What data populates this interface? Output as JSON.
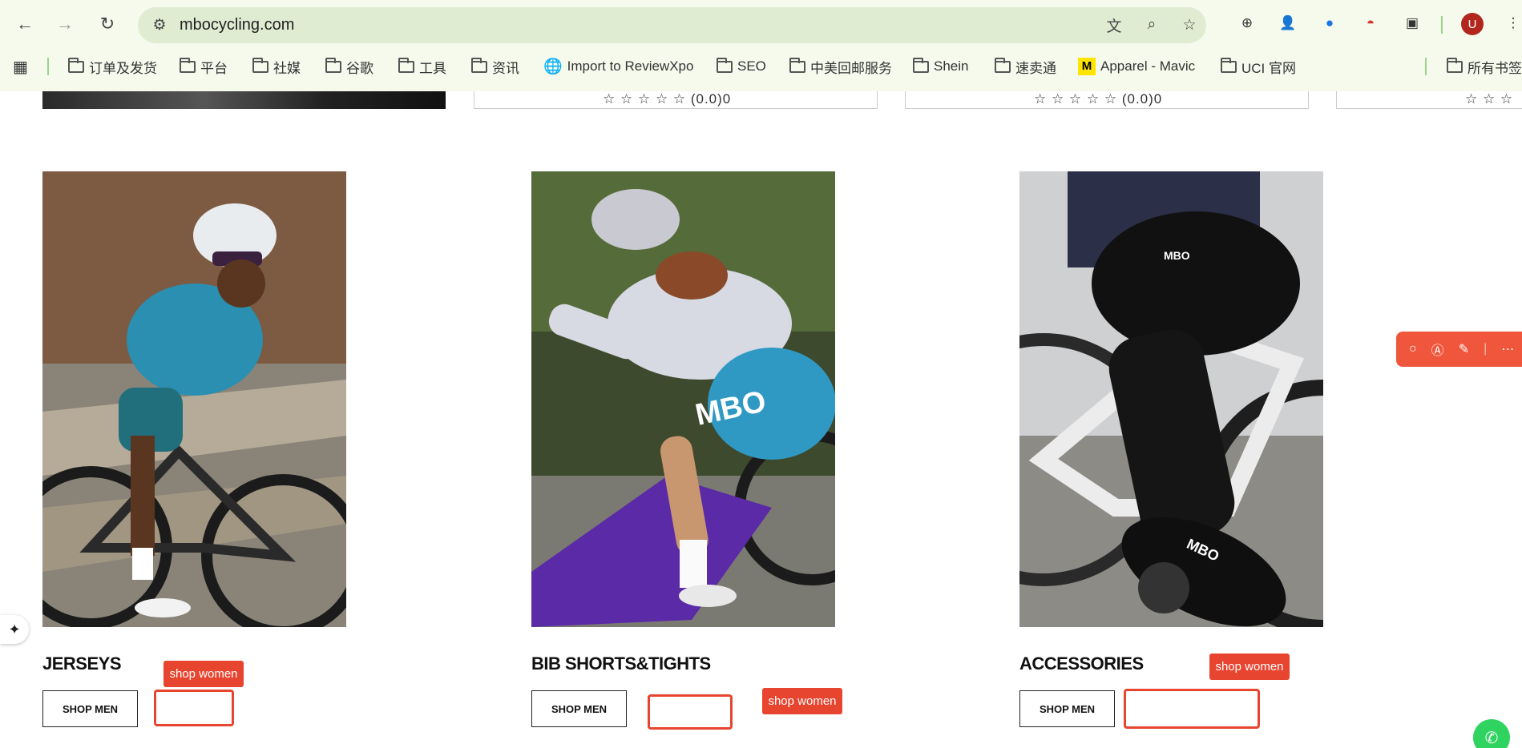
{
  "browser": {
    "url": "mbocycling.com",
    "avatar_letter": "U",
    "icons": {
      "back": "arrow-left-icon",
      "forward": "arrow-right-icon",
      "reload": "reload-icon",
      "site_info": "tune-icon",
      "translate": "translate-icon",
      "zoom": "zoom-icon",
      "bookmark": "star-icon"
    },
    "bookmarks": [
      {
        "label": "订单及发货",
        "icon": "folder-icon"
      },
      {
        "label": "平台",
        "icon": "folder-icon"
      },
      {
        "label": "社媒",
        "icon": "folder-icon"
      },
      {
        "label": "谷歌",
        "icon": "folder-icon"
      },
      {
        "label": "工具",
        "icon": "folder-icon"
      },
      {
        "label": "资讯",
        "icon": "folder-icon"
      },
      {
        "label": "Import to ReviewXpo",
        "icon": "globe-icon"
      },
      {
        "label": "SEO",
        "icon": "folder-icon"
      },
      {
        "label": "中美回邮服务",
        "icon": "folder-icon"
      },
      {
        "label": "Shein",
        "icon": "folder-icon"
      },
      {
        "label": "速卖通",
        "icon": "folder-icon"
      },
      {
        "label": "Apparel - Mavic",
        "icon": "mavic-logo-icon"
      },
      {
        "label": "UCI 官网",
        "icon": "folder-icon"
      }
    ],
    "all_bookmarks_label": "所有书签"
  },
  "page": {
    "ratings": [
      {
        "stars": "☆ ☆ ☆ ☆ ☆",
        "score": "(0.0)0"
      },
      {
        "stars": "☆ ☆ ☆ ☆ ☆",
        "score": "(0.0)0"
      },
      {
        "stars": "☆ ☆ ☆",
        "score": ""
      }
    ],
    "categories": [
      {
        "title": "JERSEYS",
        "shop_men": "SHOP MEN",
        "shop_women": "shop women"
      },
      {
        "title": "BIB SHORTS&TIGHTS",
        "shop_men": "SHOP MEN",
        "shop_women": "shop women"
      },
      {
        "title": "ACCESSORIES",
        "shop_men": "SHOP MEN",
        "shop_women": "shop women"
      }
    ],
    "colors": {
      "accent": "#e84530",
      "chrome": "#f5faed"
    }
  }
}
